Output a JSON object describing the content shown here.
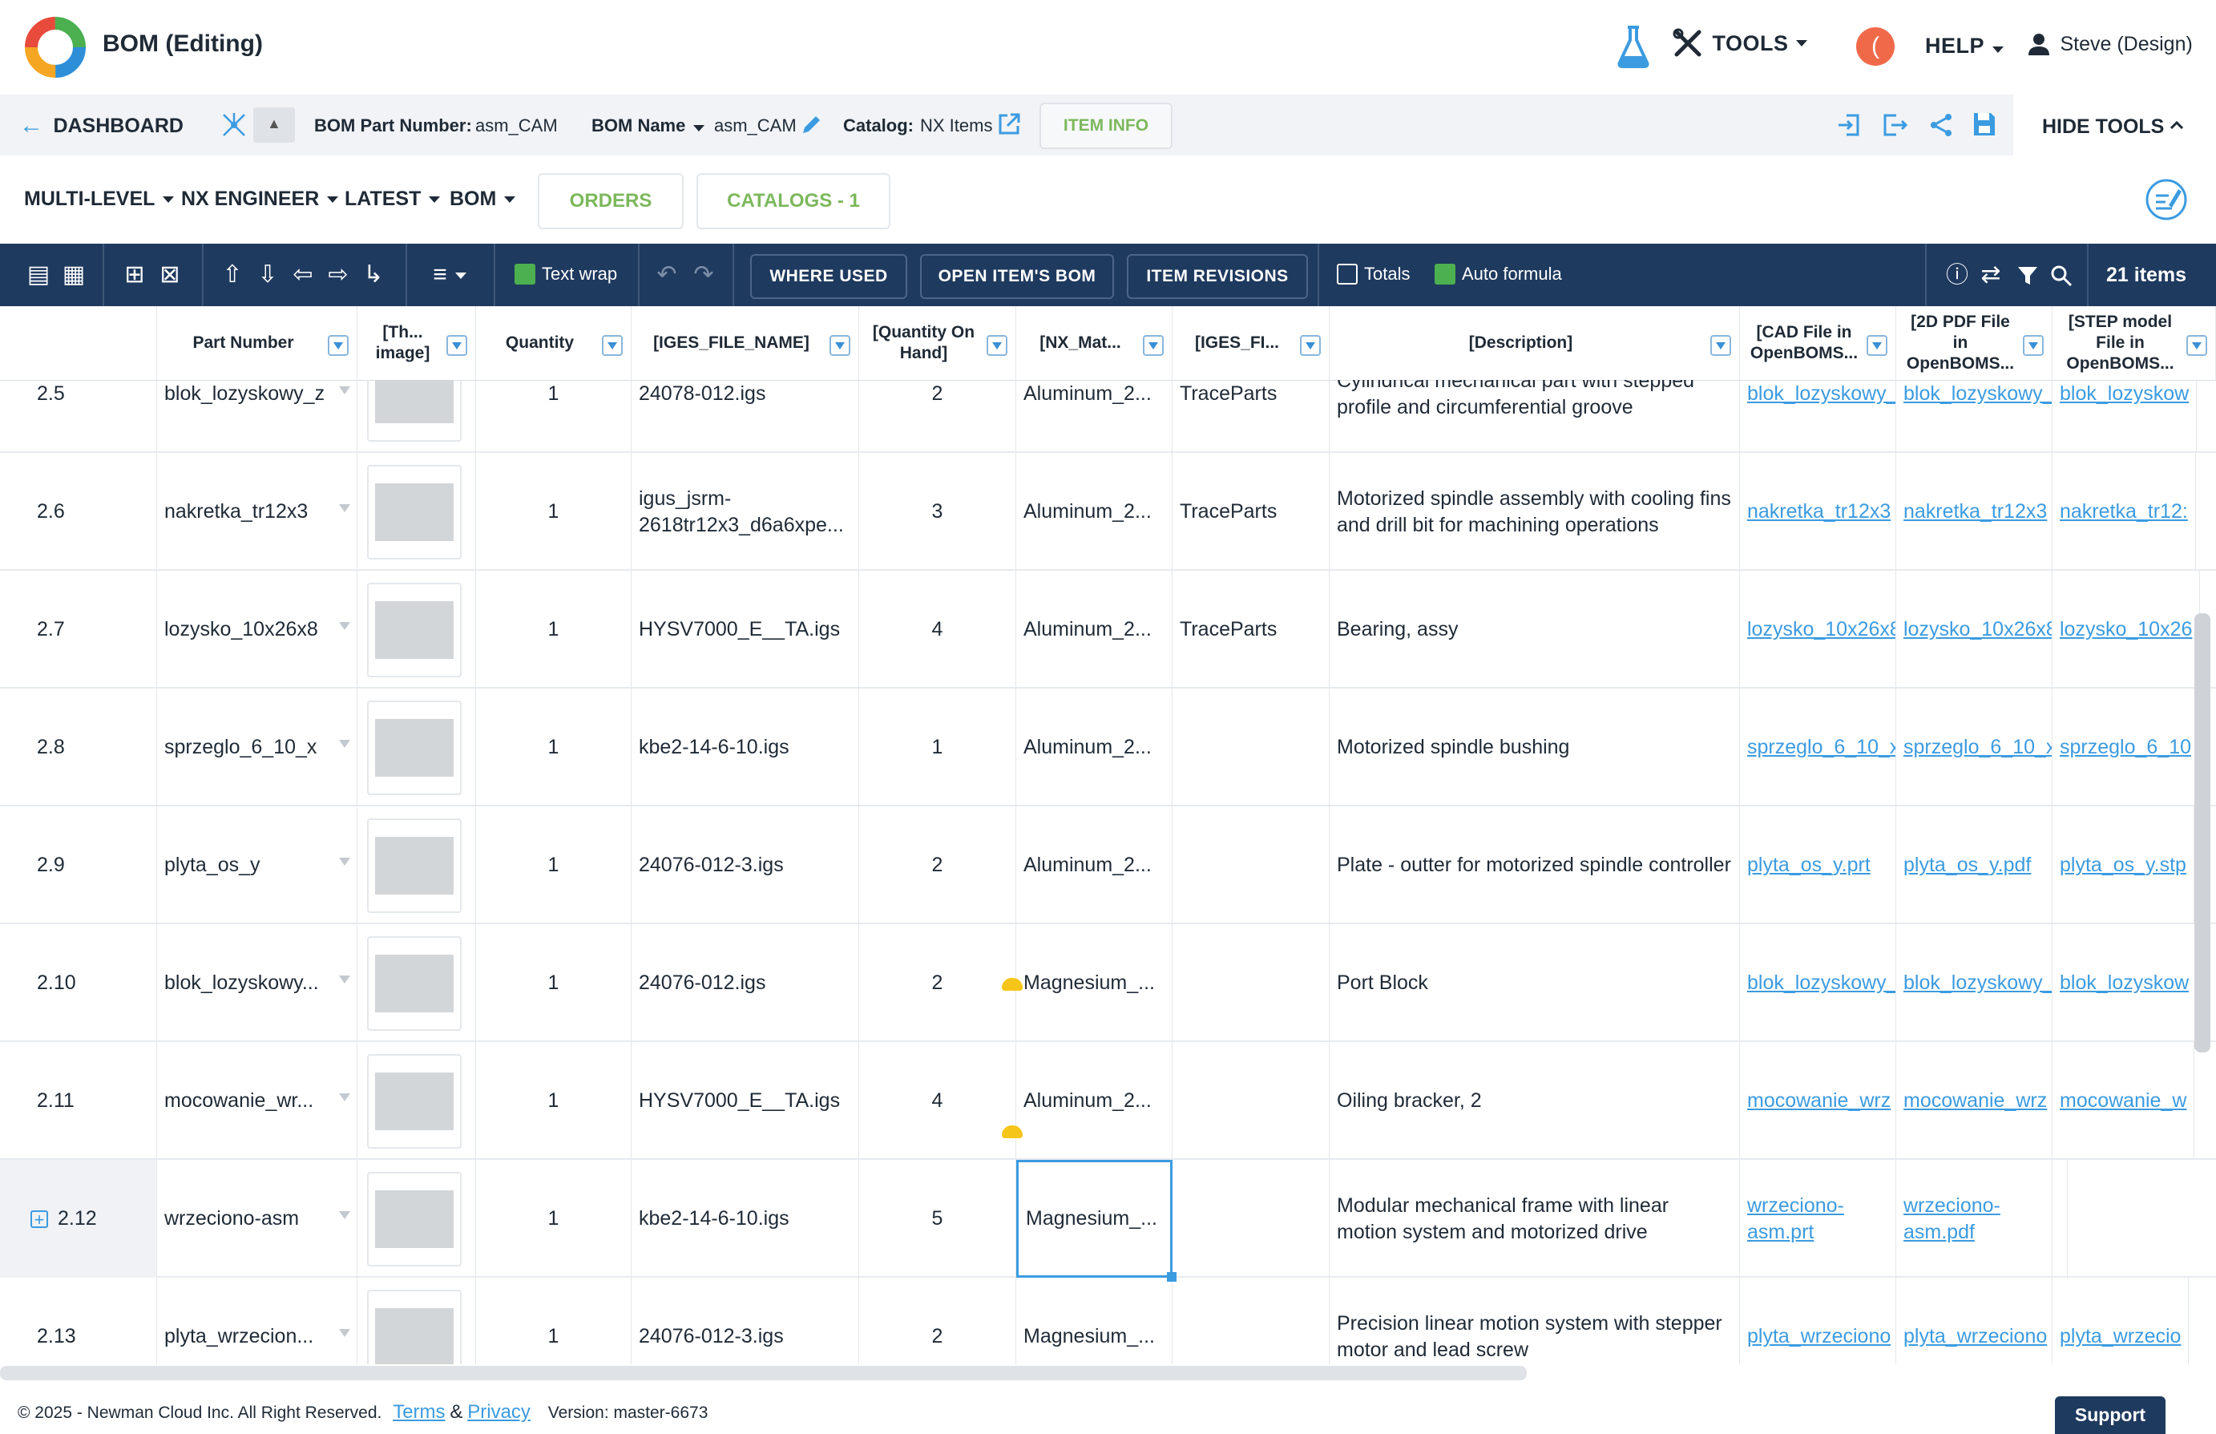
{
  "header": {
    "title": "BOM (Editing)",
    "tools_label": "TOOLS",
    "help_label": "HELP",
    "avatar_letter": "(",
    "user_name": "Steve (Design)"
  },
  "subbar": {
    "dashboard_label": "DASHBOARD",
    "part_number_label": "BOM Part Number:",
    "part_number_value": "asm_CAM",
    "bom_name_label": "BOM Name",
    "bom_name_value": "asm_CAM",
    "catalog_label": "Catalog:",
    "catalog_value": "NX Items",
    "item_info_label": "ITEM INFO",
    "hide_tools_label": "HIDE TOOLS"
  },
  "menu": {
    "multi_level": "MULTI-LEVEL",
    "nx_engineer": "NX ENGINEER",
    "latest": "LATEST",
    "bom": "BOM",
    "orders": "ORDERS",
    "catalogs": "CATALOGS - 1"
  },
  "toolbar": {
    "text_wrap": "Text wrap",
    "where_used": "WHERE USED",
    "open_items_bom": "OPEN ITEM'S BOM",
    "item_revisions": "ITEM REVISIONS",
    "totals": "Totals",
    "auto_formula": "Auto formula",
    "items_count": "21 items"
  },
  "columns": [
    "Part Number",
    "[Th... image]",
    "Quantity",
    "[IGES_FILE_NAME]",
    "[Quantity On Hand]",
    "[NX_Mat...",
    "[IGES_FI...",
    "[Description]",
    "[CAD File in OpenBOMS...",
    "[2D PDF File in OpenBOMS...",
    "[STEP model File in OpenBOMS..."
  ],
  "rows": [
    {
      "idx": "2.5",
      "part": "blok_lozyskowy_z",
      "qty": "1",
      "iges": "24078-012.igs",
      "onhand": "2",
      "mat": "Aluminum_2...",
      "igesfi": "TraceParts",
      "desc": "Cylindrical mechanical part with stepped profile and circumferential groove",
      "cad": "blok_lozyskowy_",
      "pdf": "blok_lozyskowy_",
      "step": "blok_lozyskow"
    },
    {
      "idx": "2.6",
      "part": "nakretka_tr12x3",
      "qty": "1",
      "iges": "igus_jsrm-2618tr12x3_d6a6xpe...",
      "onhand": "3",
      "mat": "Aluminum_2...",
      "igesfi": "TraceParts",
      "desc": "Motorized spindle assembly with cooling fins and drill bit for machining operations",
      "cad": "nakretka_tr12x3",
      "pdf": "nakretka_tr12x3",
      "step": "nakretka_tr12:"
    },
    {
      "idx": "2.7",
      "part": "lozysko_10x26x8",
      "qty": "1",
      "iges": "HYSV7000_E__TA.igs",
      "onhand": "4",
      "mat": "Aluminum_2...",
      "igesfi": "TraceParts",
      "desc": "Bearing, assy",
      "cad": "lozysko_10x26x8",
      "pdf": "lozysko_10x26x8",
      "step": "lozysko_10x26"
    },
    {
      "idx": "2.8",
      "part": "sprzeglo_6_10_x",
      "qty": "1",
      "iges": "kbe2-14-6-10.igs",
      "onhand": "1",
      "mat": "Aluminum_2...",
      "igesfi": "",
      "desc": "Motorized spindle bushing",
      "cad": "sprzeglo_6_10_x",
      "pdf": "sprzeglo_6_10_x",
      "step": "sprzeglo_6_10"
    },
    {
      "idx": "2.9",
      "part": "plyta_os_y",
      "qty": "1",
      "iges": "24076-012-3.igs",
      "onhand": "2",
      "mat": "Aluminum_2...",
      "igesfi": "",
      "desc": "Plate - outter for motorized spindle controller",
      "cad": "plyta_os_y.prt",
      "pdf": "plyta_os_y.pdf",
      "step": "plyta_os_y.stp"
    },
    {
      "idx": "2.10",
      "part": "blok_lozyskowy...",
      "qty": "1",
      "iges": "24076-012.igs",
      "onhand": "2",
      "mat": "Magnesium_...",
      "igesfi": "",
      "desc": "Port Block",
      "cad": "blok_lozyskowy_",
      "pdf": "blok_lozyskowy_",
      "step": "blok_lozyskow"
    },
    {
      "idx": "2.11",
      "part": "mocowanie_wr...",
      "qty": "1",
      "iges": "HYSV7000_E__TA.igs",
      "onhand": "4",
      "mat": "Aluminum_2...",
      "igesfi": "",
      "desc": "Oiling bracker, 2",
      "cad": "mocowanie_wrz",
      "pdf": "mocowanie_wrz",
      "step": "mocowanie_w"
    },
    {
      "idx": "2.12",
      "part": "wrzeciono-asm",
      "qty": "1",
      "iges": "kbe2-14-6-10.igs",
      "onhand": "5",
      "mat": "Magnesium_...",
      "igesfi": "",
      "desc": "Modular mechanical frame with linear motion system and motorized drive",
      "cad": "wrzeciono-asm.prt",
      "pdf": "wrzeciono-asm.pdf",
      "step": ""
    },
    {
      "idx": "2.13",
      "part": "plyta_wrzecion...",
      "qty": "1",
      "iges": "24076-012-3.igs",
      "onhand": "2",
      "mat": "Magnesium_...",
      "igesfi": "",
      "desc": "Precision linear motion system with stepper motor and lead screw",
      "cad": "plyta_wrzeciono",
      "pdf": "plyta_wrzeciono",
      "step": "plyta_wrzecio"
    }
  ],
  "footer": {
    "copyright": "© 2025 - Newman Cloud Inc. All Right Reserved.",
    "terms": "Terms",
    "amp": "&",
    "privacy": "Privacy",
    "version": "Version: master-6673",
    "support": "Support"
  },
  "colors": {
    "toolbar_bg": "#1f3a5f",
    "accent_green": "#7cb85c",
    "link_blue": "#3b9be0",
    "avatar_orange": "#f06a4a"
  }
}
